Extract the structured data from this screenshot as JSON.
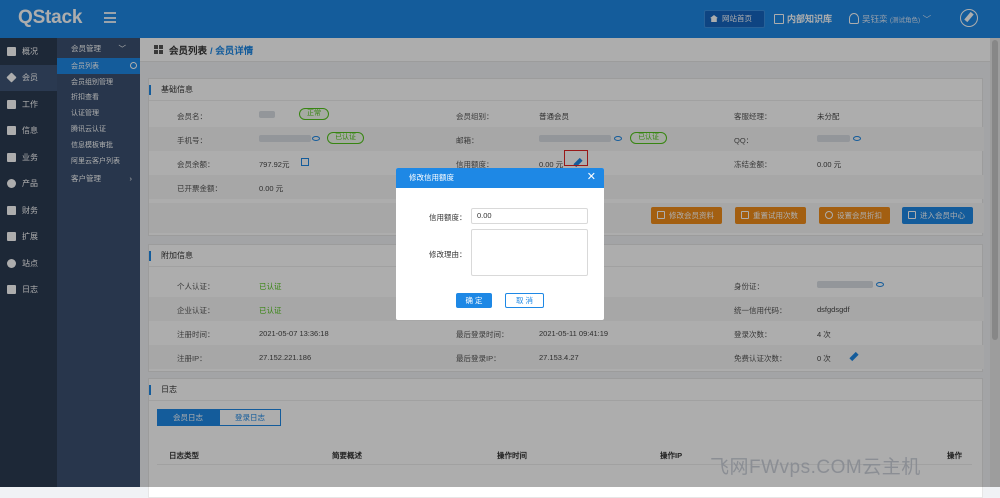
{
  "app": {
    "logo": "QStack"
  },
  "topbar": {
    "site_home": "网站首页",
    "knowledge": "内部知识库",
    "user_name": "吴钰栾",
    "user_role": "(测试角色)"
  },
  "sidebar": {
    "items": [
      {
        "label": "概况",
        "icon": "home-icon"
      },
      {
        "label": "会员",
        "icon": "diamond-icon",
        "active": true
      },
      {
        "label": "工作",
        "icon": "calendar-icon"
      },
      {
        "label": "信息",
        "icon": "cube-icon"
      },
      {
        "label": "业务",
        "icon": "briefcase-icon"
      },
      {
        "label": "产品",
        "icon": "globe-icon"
      },
      {
        "label": "财务",
        "icon": "bar-chart-icon"
      },
      {
        "label": "扩展",
        "icon": "code-icon"
      },
      {
        "label": "站点",
        "icon": "gear-icon"
      },
      {
        "label": "日志",
        "icon": "list-icon"
      }
    ]
  },
  "subsidebar": {
    "group1": "会员管理",
    "items": [
      "会员列表",
      "会员组别管理",
      "折扣查看",
      "认证管理",
      "腾讯云认证",
      "信息模板审批",
      "阿里云客户列表"
    ],
    "group2": "客户管理"
  },
  "page": {
    "title": "会员列表",
    "breadcrumb": "/ 会员详情"
  },
  "basic": {
    "title": "基础信息",
    "member_name_label": "会员名：",
    "status_tag": "正常",
    "group_label": "会员组别：",
    "group_value": "普通会员",
    "manager_label": "客服经理：",
    "manager_value": "未分配",
    "phone_label": "手机号：",
    "verified_tag": "已认证",
    "email_label": "邮箱：",
    "email_verified_tag": "已认证",
    "qq_label": "QQ：",
    "balance_label": "会员余额：",
    "balance_value": "797.92元",
    "credit_label": "信用额度：",
    "credit_value": "0.00 元",
    "frozen_label": "冻结金额：",
    "frozen_value": "0.00 元",
    "invoiced_label": "已开票金额：",
    "invoiced_value": "0.00 元"
  },
  "actions": {
    "edit": "修改会员资料",
    "reset": "重置试用次数",
    "discount": "设置会员折扣",
    "enter": "进入会员中心"
  },
  "extra": {
    "title": "附加信息",
    "personal_label": "个人认证：",
    "personal_value": "已认证",
    "idcard_label": "身份证：",
    "company_label": "企业认证：",
    "company_value": "已认证",
    "uscc_label": "统一信用代码：",
    "uscc_value": "dsfgdsgdf",
    "reg_time_label": "注册时间：",
    "reg_time_value": "2021-05-07 13:36:18",
    "last_login_label": "最后登录时间：",
    "last_login_value": "2021-05-11 09:41:19",
    "login_count_label": "登录次数：",
    "login_count_value": "4 次",
    "reg_ip_label": "注册IP：",
    "reg_ip_value": "27.152.221.186",
    "last_ip_label": "最后登录IP：",
    "last_ip_value": "27.153.4.27",
    "free_auth_label": "免费认证次数：",
    "free_auth_value": "0 次"
  },
  "log": {
    "title": "日志",
    "tabs": [
      "会员日志",
      "登录日志"
    ],
    "columns": [
      "日志类型",
      "简要概述",
      "操作时间",
      "操作IP",
      "操作"
    ]
  },
  "modal": {
    "title": "修改信用额度",
    "credit_label": "信用额度：",
    "credit_value": "0.00",
    "reason_label": "修改理由：",
    "ok": "确 定",
    "cancel": "取 消"
  },
  "watermark": "飞网FWvps.COM云主机"
}
